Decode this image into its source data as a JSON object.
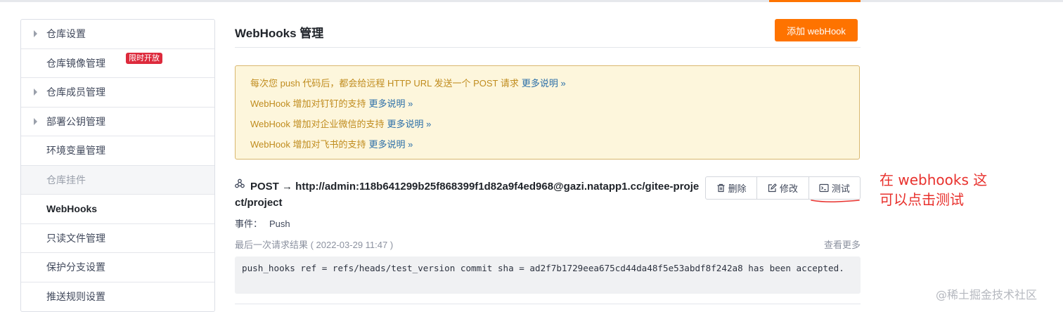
{
  "sidebar": {
    "items": [
      {
        "label": "仓库设置"
      },
      {
        "label": "仓库镜像管理",
        "badge": "限时开放"
      },
      {
        "label": "仓库成员管理"
      },
      {
        "label": "部署公钥管理"
      },
      {
        "label": "环境变量管理"
      },
      {
        "label": "仓库挂件"
      },
      {
        "label": "WebHooks"
      },
      {
        "label": "只读文件管理"
      },
      {
        "label": "保护分支设置"
      },
      {
        "label": "推送规则设置"
      }
    ]
  },
  "main": {
    "title": "WebHooks 管理",
    "add_button": "添加 webHook",
    "notice": {
      "lines": [
        {
          "text": "每次您 push 代码后，都会给远程 HTTP URL 发送一个 POST 请求",
          "link": "更多说明 »"
        },
        {
          "text": "WebHook 增加对钉钉的支持",
          "link": "更多说明 »"
        },
        {
          "text": "WebHook 增加对企业微信的支持",
          "link": "更多说明 »"
        },
        {
          "text": "WebHook 增加对飞书的支持",
          "link": "更多说明 »"
        }
      ]
    },
    "hook": {
      "url": "POST → http://admin:118b641299b25f868399f1d82a9f4ed968@gazi.natapp1.cc/gitee-project/project",
      "buttons": {
        "delete": "删除",
        "edit": "修改",
        "test": "测试"
      },
      "event_label": "事件：",
      "event_value": "Push",
      "last_result": "最后一次请求结果 ( 2022-03-29 11:47 )",
      "view_more": "查看更多",
      "result_output": "push_hooks ref = refs/heads/test_version commit sha = ad2f7b1729eea675cd44da48f5e53abdf8f242a8 has been accepted."
    }
  },
  "annotation": {
    "line1": "在 webhooks 这",
    "line2": "可以点击测试"
  },
  "watermark": "@稀土掘金技术社区",
  "colors": {
    "accent": "#fe7300",
    "badge": "#dd2a3c",
    "annotation": "#e8312d"
  }
}
